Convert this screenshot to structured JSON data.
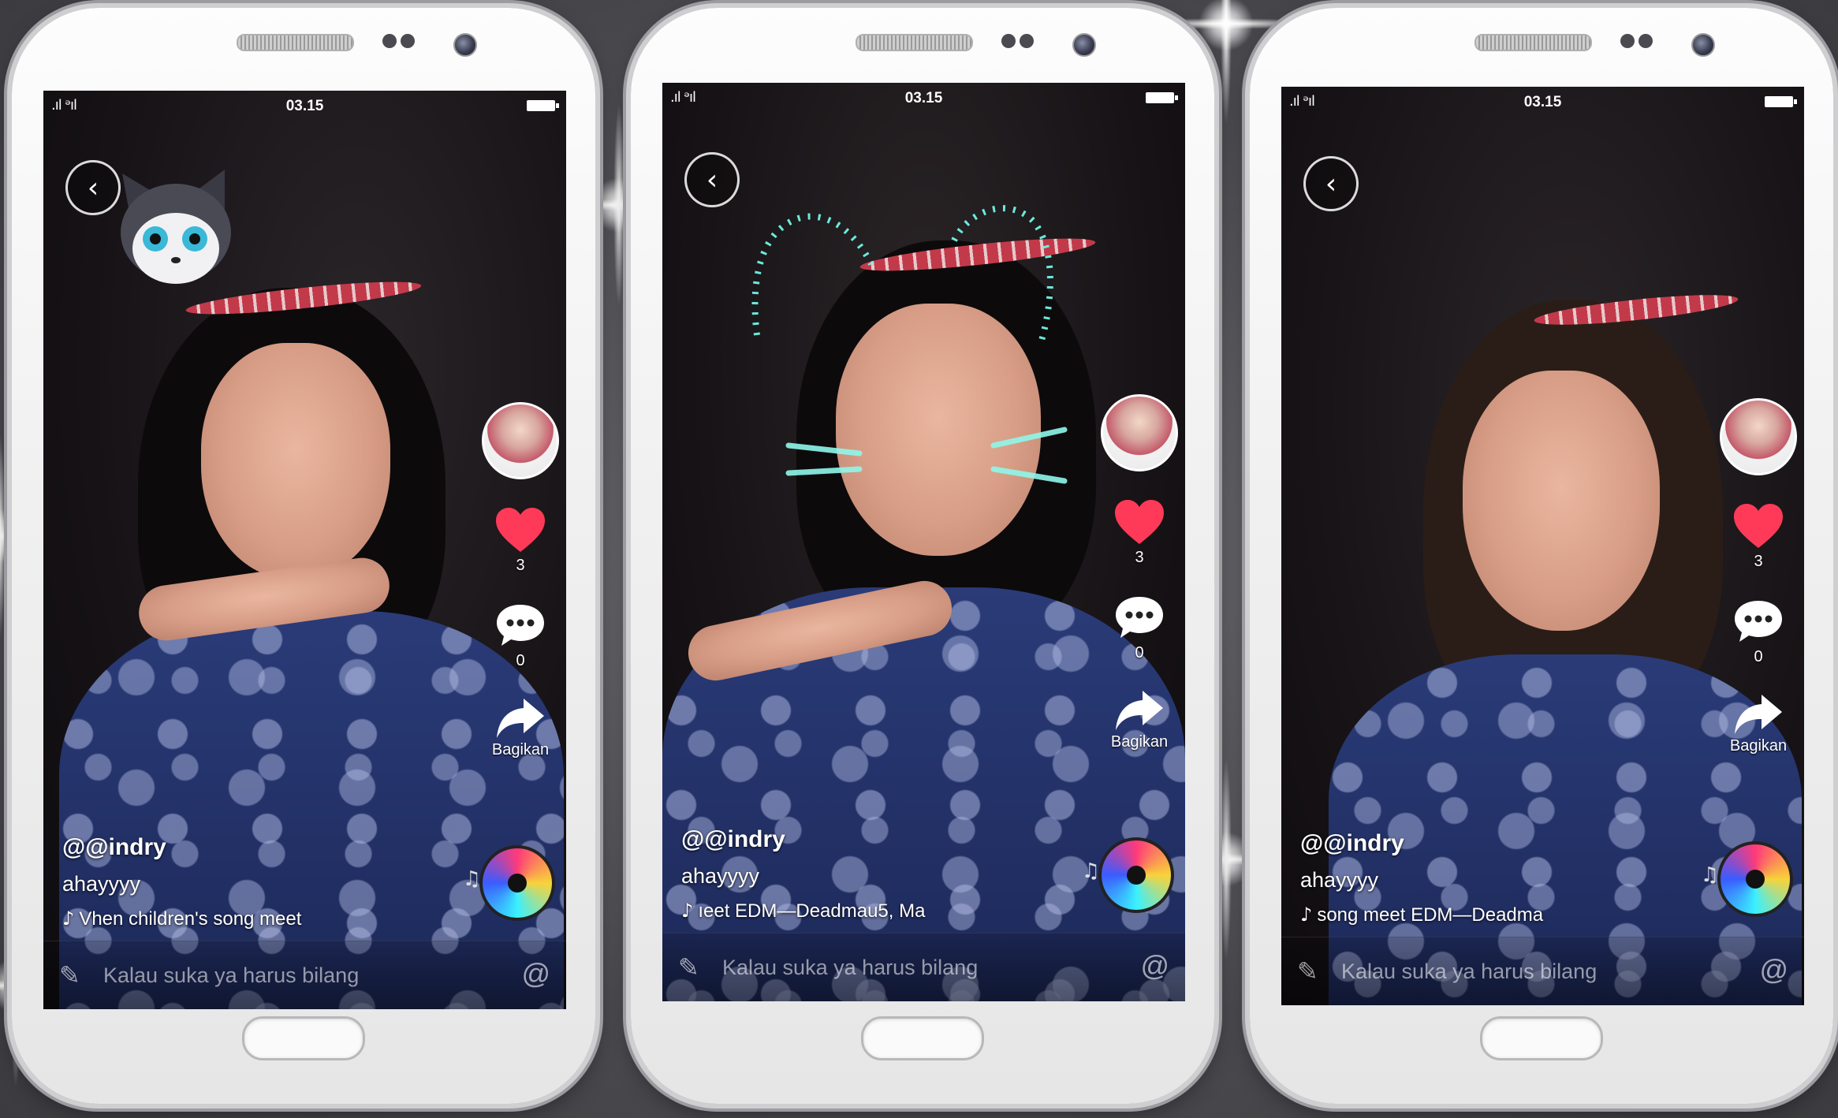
{
  "phones": [
    {
      "status": {
        "signal": ".ıl ᵊıl",
        "time": "03.15"
      },
      "username": "@@indry",
      "description": "ahayyyy",
      "music": "Vhen children's song meet",
      "likes": "3",
      "comments": "0",
      "share_label": "Bagikan",
      "comment_placeholder": "Kalau suka ya harus bilang",
      "at_symbol": "@"
    },
    {
      "status": {
        "signal": ".ıl ᵊıl",
        "time": "03.15"
      },
      "username": "@@indry",
      "description": "ahayyyy",
      "music": "ıeet EDM—Deadmau5, Ma",
      "likes": "3",
      "comments": "0",
      "share_label": "Bagikan",
      "comment_placeholder": "Kalau suka ya harus bilang",
      "at_symbol": "@"
    },
    {
      "status": {
        "signal": ".ıl ᵊıl",
        "time": "03.15"
      },
      "username": "@@indry",
      "description": "ahayyyy",
      "music": "song meet EDM—Deadma",
      "likes": "3",
      "comments": "0",
      "share_label": "Bagikan",
      "comment_placeholder": "Kalau suka ya harus bilang",
      "at_symbol": "@"
    }
  ],
  "colors": {
    "like_heart": "#ff3a58",
    "background": "#55555a",
    "shirt_blue": "#243370"
  },
  "icons": {
    "back": "chevron-left-icon",
    "like": "heart-icon",
    "comment": "comment-dots-icon",
    "share": "share-arrow-icon",
    "music": "music-note-icon",
    "edit": "pencil-icon",
    "mention": "at-icon"
  }
}
